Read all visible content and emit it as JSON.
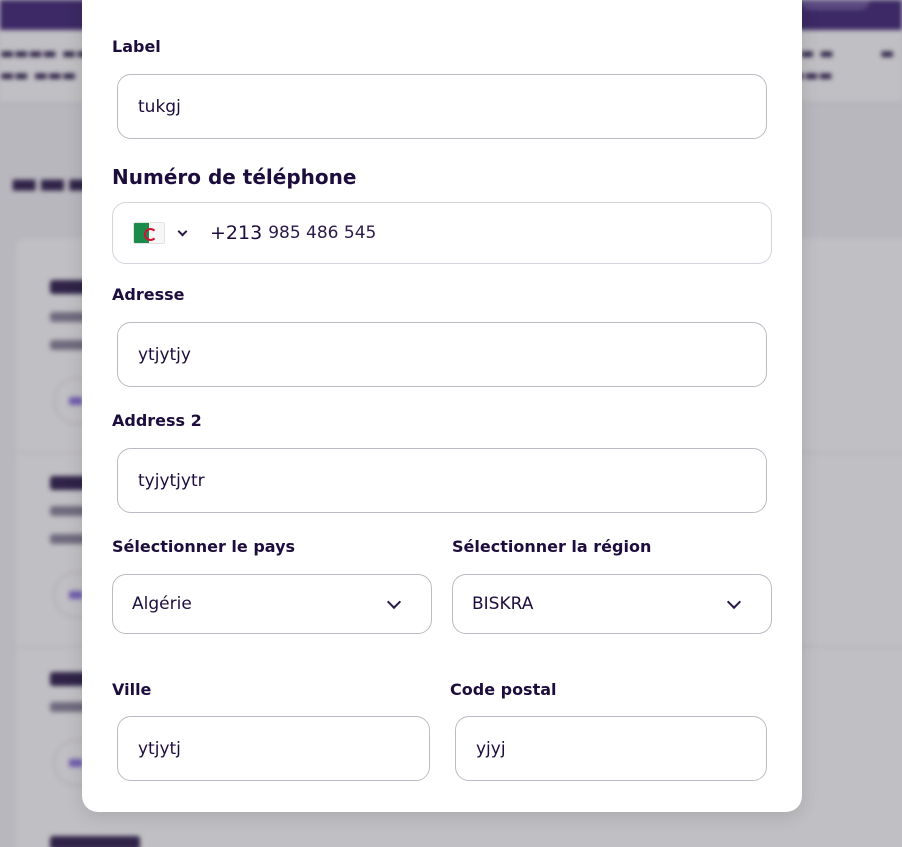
{
  "form": {
    "label": {
      "label": "Label",
      "value": "tukgj"
    },
    "phone": {
      "label": "Numéro de téléphone",
      "flag_icon": "algeria-flag-icon",
      "dial_code": "+213",
      "number": "985 486 545"
    },
    "address": {
      "label": "Adresse",
      "value": "ytjytjy"
    },
    "address2": {
      "label": "Address 2",
      "value": "tyjytjytr"
    },
    "country": {
      "label": "Sélectionner le pays",
      "value": "Algérie"
    },
    "region": {
      "label": "Sélectionner la région",
      "value": "BISKRA"
    },
    "city": {
      "label": "Ville",
      "value": "ytjytj"
    },
    "postal_code": {
      "label": "Code postal",
      "value": "yjyj"
    }
  },
  "colors": {
    "brand_purple": "#3d2275",
    "text_dark": "#1d0d3d",
    "input_border": "#bdbac4"
  }
}
